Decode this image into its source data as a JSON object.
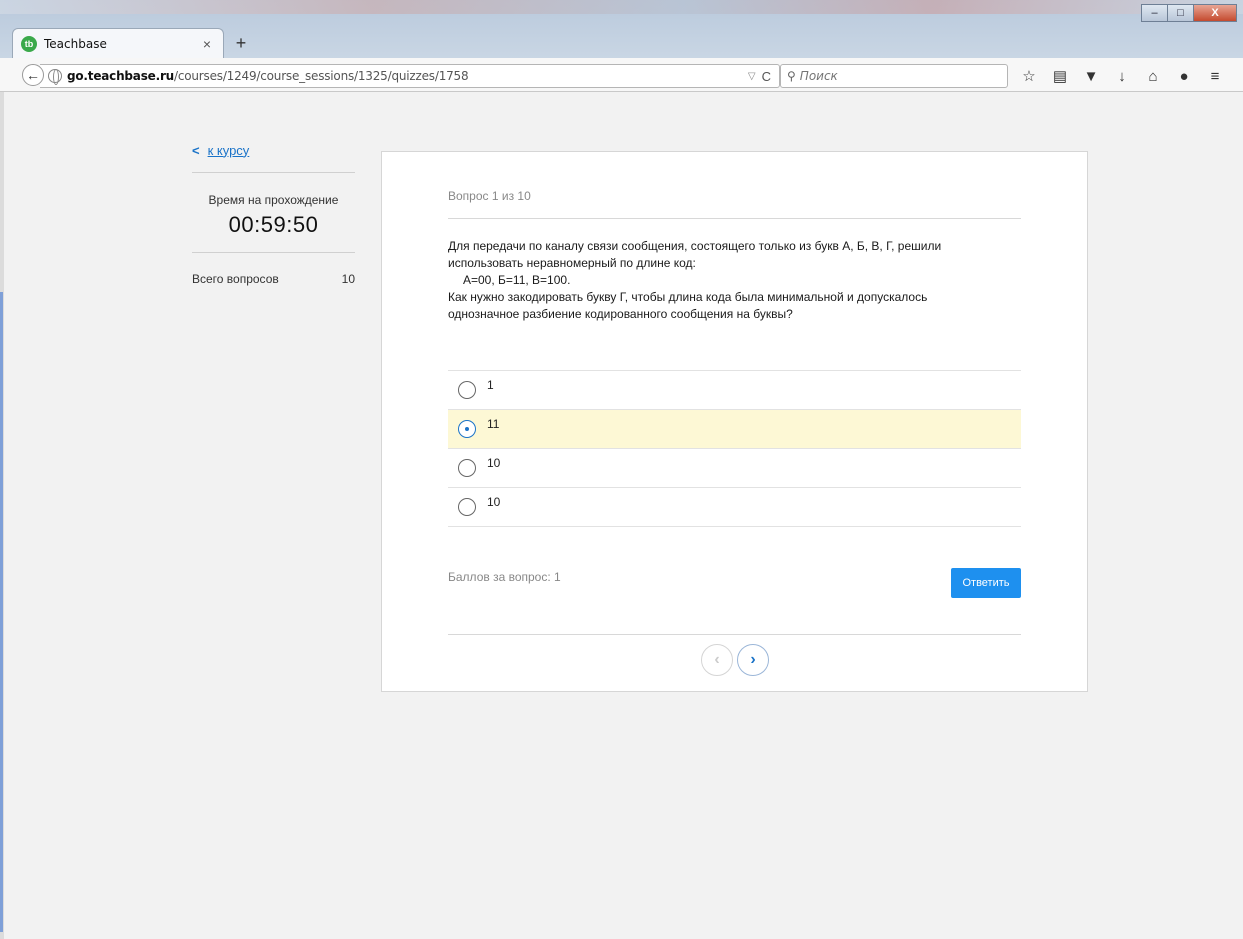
{
  "browser": {
    "tab_title": "Teachbase",
    "tab_favicon": "tb",
    "tab_close": "×",
    "new_tab": "+",
    "url_domain": "go.teachbase.ru",
    "url_path": "/courses/1249/course_sessions/1325/quizzes/1758",
    "search_placeholder": "Поиск",
    "window_controls": {
      "minimize": "–",
      "maximize": "□",
      "close": "X"
    },
    "toolbar_icons": [
      "star-icon",
      "reading-list-icon",
      "pocket-icon",
      "download-icon",
      "home-icon",
      "hello-icon",
      "menu-icon"
    ]
  },
  "sidebar": {
    "back_link": "к курсу",
    "timer_label": "Время на прохождение",
    "timer_value": "00:59:50",
    "total_label": "Всего вопросов",
    "total_value": "10"
  },
  "quiz": {
    "counter": "Вопрос 1 из 10",
    "question_lines": [
      "Для передачи по каналу связи сообщения, состоящего только из букв А, Б, В, Г, решили",
      "использовать неравномерный по длине код:",
      "А=00, Б=11, В=100.",
      "Как нужно закодировать букву Г, чтобы длина кода была минимальной и допускалось",
      "однозначное разбиение кодированного сообщения на буквы?"
    ],
    "options": [
      {
        "label": "1",
        "selected": false
      },
      {
        "label": "11",
        "selected": true
      },
      {
        "label": "10",
        "selected": false
      },
      {
        "label": "10",
        "selected": false
      }
    ],
    "points": "Баллов за вопрос: 1",
    "answer_button": "Ответить",
    "prev_glyph": "‹",
    "next_glyph": "›"
  },
  "colors": {
    "accent": "#1e90ef",
    "link": "#1a73c8",
    "selected_bg": "#fdf8d5",
    "page_bg": "#f2f2f2"
  }
}
